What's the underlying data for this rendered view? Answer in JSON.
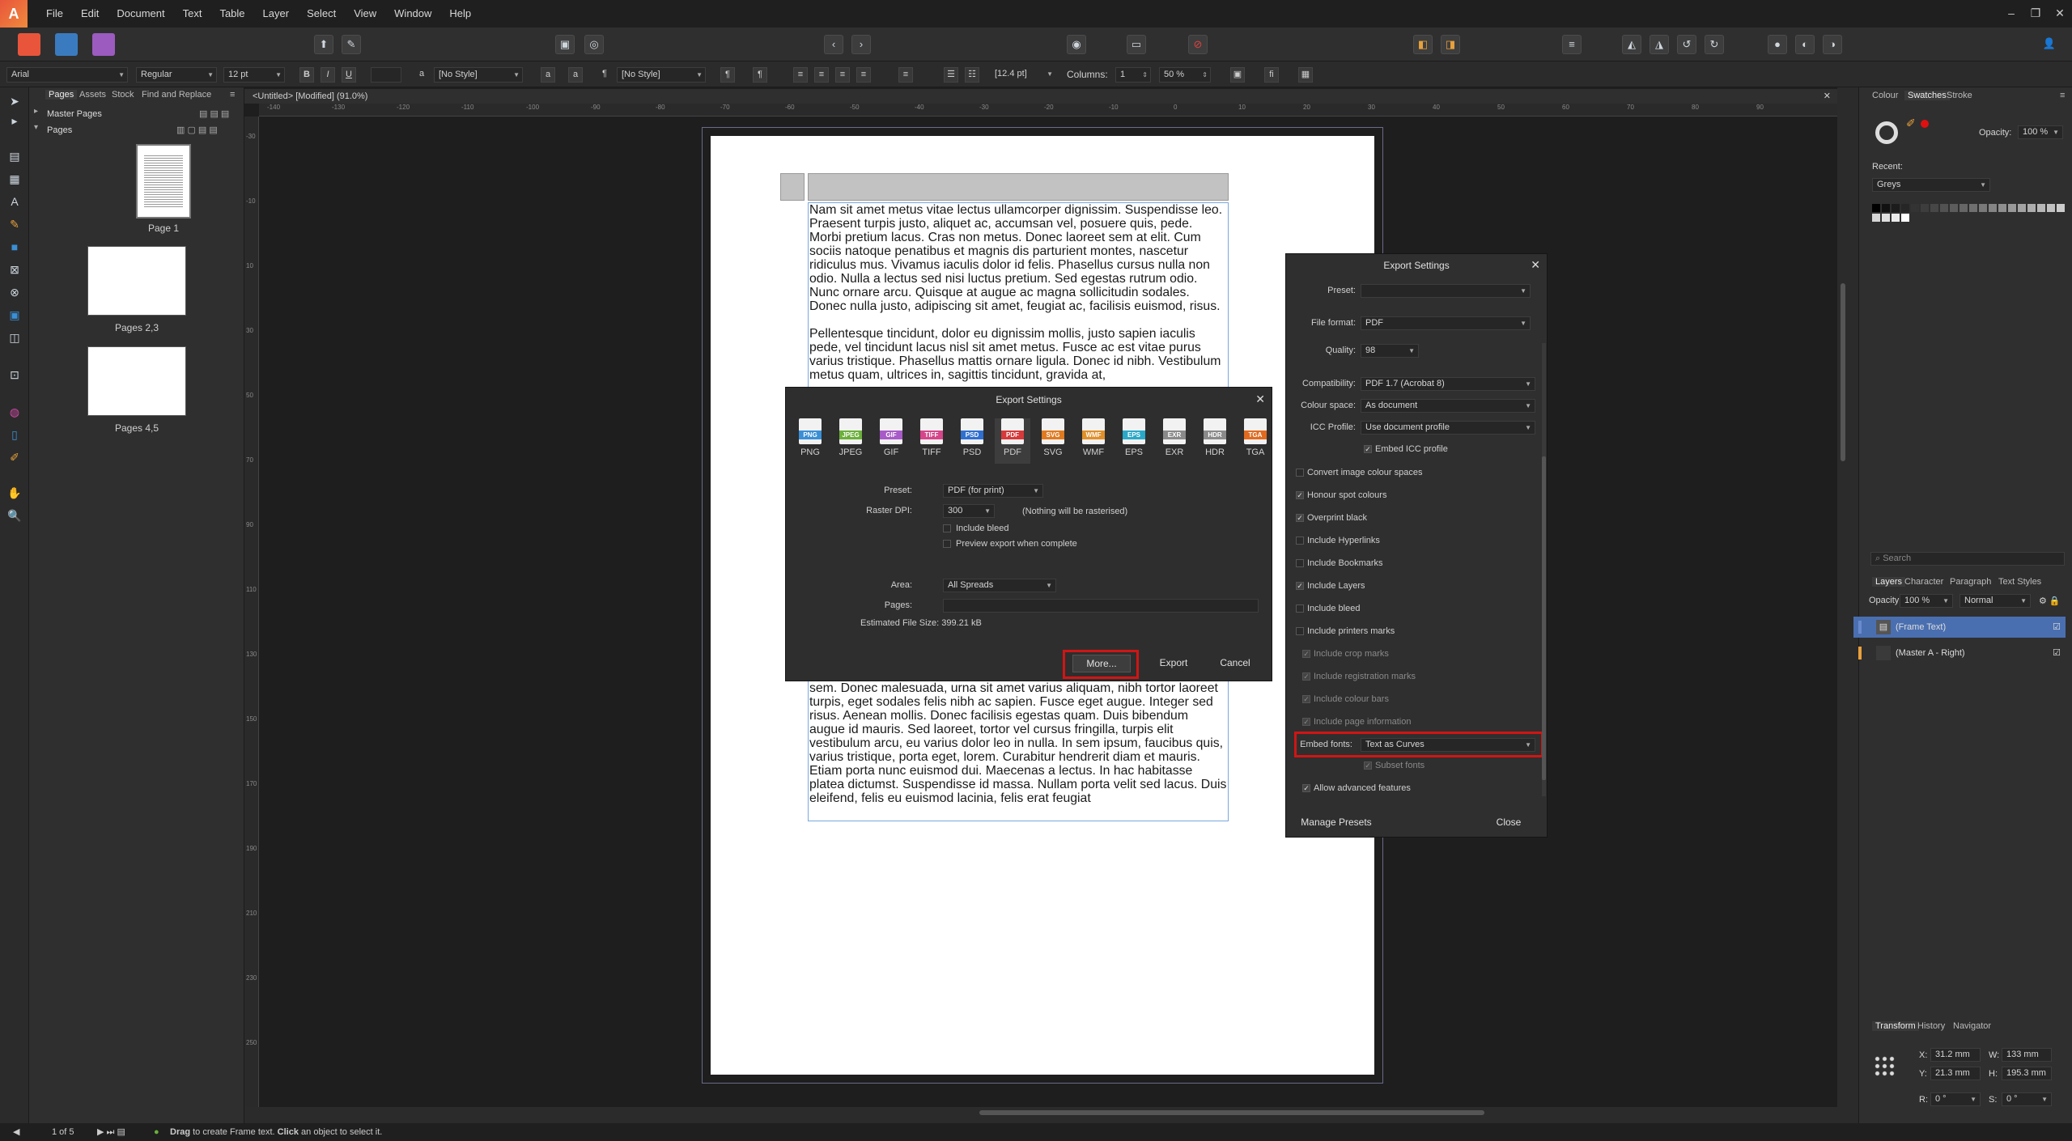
{
  "menu": [
    "File",
    "Edit",
    "Document",
    "Text",
    "Table",
    "Layer",
    "Select",
    "View",
    "Window",
    "Help"
  ],
  "context": {
    "font": "Arial",
    "style": "Regular",
    "size": "12 pt",
    "char_style": "[No Style]",
    "para_style": "[No Style]",
    "leading": "[12.4 pt]",
    "columns_label": "Columns:",
    "columns_value": "1",
    "gutter": "50 %"
  },
  "pages_panel": {
    "tabs": [
      "Pages",
      "Assets",
      "Stock",
      "Find and Replace"
    ],
    "master_pages": "Master Pages",
    "pages": "Pages",
    "thumbs": [
      "Page 1",
      "Pages 2,3",
      "Pages 4,5"
    ]
  },
  "document": {
    "tab_title": "<Untitled> [Modified] (91.0%)",
    "para1": "Nam sit amet metus vitae lectus ullamcorper dignissim. Suspendisse leo. Praesent turpis justo, aliquet ac, accumsan vel, posuere quis, pede. Morbi pretium lacus. Cras non metus. Donec laoreet sem at elit. Cum sociis natoque penatibus et magnis dis parturient montes, nascetur ridiculus mus. Vivamus iaculis dolor id felis. Phasellus cursus nulla non odio. Nulla a lectus sed nisi luctus pretium. Sed egestas rutrum odio. Nunc ornare arcu. Quisque at augue ac magna sollicitudin sodales. Donec nulla justo, adipiscing sit amet, feugiat ac, facilisis euismod, risus.",
    "para2": "Pellentesque tincidunt, dolor eu dignissim mollis, justo sapien iaculis pede, vel tincidunt lacus nisl sit amet metus. Fusce ac est vitae purus varius tristique. Phasellus mattis ornare ligula. Donec id nibh. Vestibulum metus quam, ultrices in, sagittis tincidunt, gravida at,",
    "para3": "augue. Donec aliquam magna nonummy enim. Proin blandit imperdiet sem. Donec malesuada, urna sit amet varius aliquam, nibh tortor laoreet turpis, eget sodales felis  nibh ac sapien. Fusce eget augue. Integer sed risus. Aenean mollis. Donec facilisis egestas quam. Duis bibendum augue  id mauris. Sed laoreet, tortor vel cursus fringilla, turpis elit vestibulum arcu, eu varius dolor leo in nulla. In sem ipsum, faucibus quis, varius tristique, porta eget, lorem. Curabitur hendrerit diam et mauris. Etiam porta nunc euismod dui. Maecenas a lectus. In hac habitasse platea dictumst. Suspendisse id massa. Nullam porta velit sed lacus. Duis eleifend, felis eu euismod lacinia, felis erat feugiat"
  },
  "export_dialog": {
    "title": "Export Settings",
    "formats": [
      {
        "label": "PNG",
        "color": "#3a8fd6"
      },
      {
        "label": "JPEG",
        "color": "#6bb03a"
      },
      {
        "label": "GIF",
        "color": "#a85ac8"
      },
      {
        "label": "TIFF",
        "color": "#d6458a"
      },
      {
        "label": "PSD",
        "color": "#2f6fd0"
      },
      {
        "label": "PDF",
        "color": "#d63a3a"
      },
      {
        "label": "SVG",
        "color": "#e07a20"
      },
      {
        "label": "WMF",
        "color": "#e0902a"
      },
      {
        "label": "EPS",
        "color": "#2aa8c8"
      },
      {
        "label": "EXR",
        "color": "#8a8a8a"
      },
      {
        "label": "HDR",
        "color": "#8a8a8a"
      },
      {
        "label": "TGA",
        "color": "#e06a20"
      }
    ],
    "preset_label": "Preset:",
    "preset_value": "PDF (for print)",
    "dpi_label": "Raster DPI:",
    "dpi_value": "300",
    "dpi_note": "(Nothing will be rasterised)",
    "include_bleed": "Include bleed",
    "preview_export": "Preview export when complete",
    "area_label": "Area:",
    "area_value": "All Spreads",
    "pages_label": "Pages:",
    "file_size": "Estimated File Size: 399.21 kB",
    "more_btn": "More...",
    "export_btn": "Export",
    "cancel_btn": "Cancel"
  },
  "settings_panel": {
    "title": "Export Settings",
    "preset_label": "Preset:",
    "file_format_label": "File format:",
    "file_format_value": "PDF",
    "quality_label": "Quality:",
    "quality_value": "98",
    "compatibility_label": "Compatibility:",
    "compatibility_value": "PDF 1.7 (Acrobat 8)",
    "colour_space_label": "Colour space:",
    "colour_space_value": "As document",
    "icc_label": "ICC Profile:",
    "icc_value": "Use document profile",
    "embed_icc": "Embed ICC profile",
    "checks": [
      {
        "label": "Convert image colour spaces",
        "on": false,
        "dim": false
      },
      {
        "label": "Honour spot colours",
        "on": true,
        "dim": false
      },
      {
        "label": "Overprint black",
        "on": true,
        "dim": false
      },
      {
        "label": "Include Hyperlinks",
        "on": false,
        "dim": false
      },
      {
        "label": "Include Bookmarks",
        "on": false,
        "dim": false
      },
      {
        "label": "Include Layers",
        "on": true,
        "dim": false
      },
      {
        "label": "Include bleed",
        "on": false,
        "dim": false
      },
      {
        "label": "Include printers marks",
        "on": false,
        "dim": false
      },
      {
        "label": "Include crop marks",
        "on": true,
        "dim": true
      },
      {
        "label": "Include registration marks",
        "on": true,
        "dim": true
      },
      {
        "label": "Include colour bars",
        "on": true,
        "dim": true
      },
      {
        "label": "Include page information",
        "on": true,
        "dim": true
      }
    ],
    "embed_fonts_label": "Embed fonts:",
    "embed_fonts_value": "Text as Curves",
    "subset_fonts": "Subset fonts",
    "advanced": "Allow advanced features",
    "manage_presets": "Manage Presets",
    "close": "Close"
  },
  "right_panel": {
    "colour_tabs": [
      "Colour",
      "Swatches",
      "Stroke"
    ],
    "opacity_label": "Opacity:",
    "opacity_value": "100 %",
    "recent_label": "Recent:",
    "palette": "Greys",
    "search_placeholder": "Search",
    "layer_tabs": [
      "Layers",
      "Character",
      "Paragraph",
      "Text Styles"
    ],
    "layer_opacity_label": "Opacity:",
    "layer_opacity_value": "100 %",
    "blend_mode": "Normal",
    "layers": [
      "(Frame Text)",
      "(Master A - Right)"
    ],
    "transform_tabs": [
      "Transform",
      "History",
      "Navigator"
    ],
    "x_label": "X:",
    "x_value": "31.2 mm",
    "y_label": "Y:",
    "y_value": "21.3 mm",
    "w_label": "W:",
    "w_value": "133 mm",
    "h_label": "H:",
    "h_value": "195.3 mm",
    "r_label": "R:",
    "r_value": "0 °",
    "s_label": "S:",
    "s_value": "0 °"
  },
  "status": {
    "page_count": "1 of 5",
    "drag": "Drag",
    "drag_text": "to create Frame text.",
    "click": "Click",
    "click_text": "an object to select it."
  }
}
